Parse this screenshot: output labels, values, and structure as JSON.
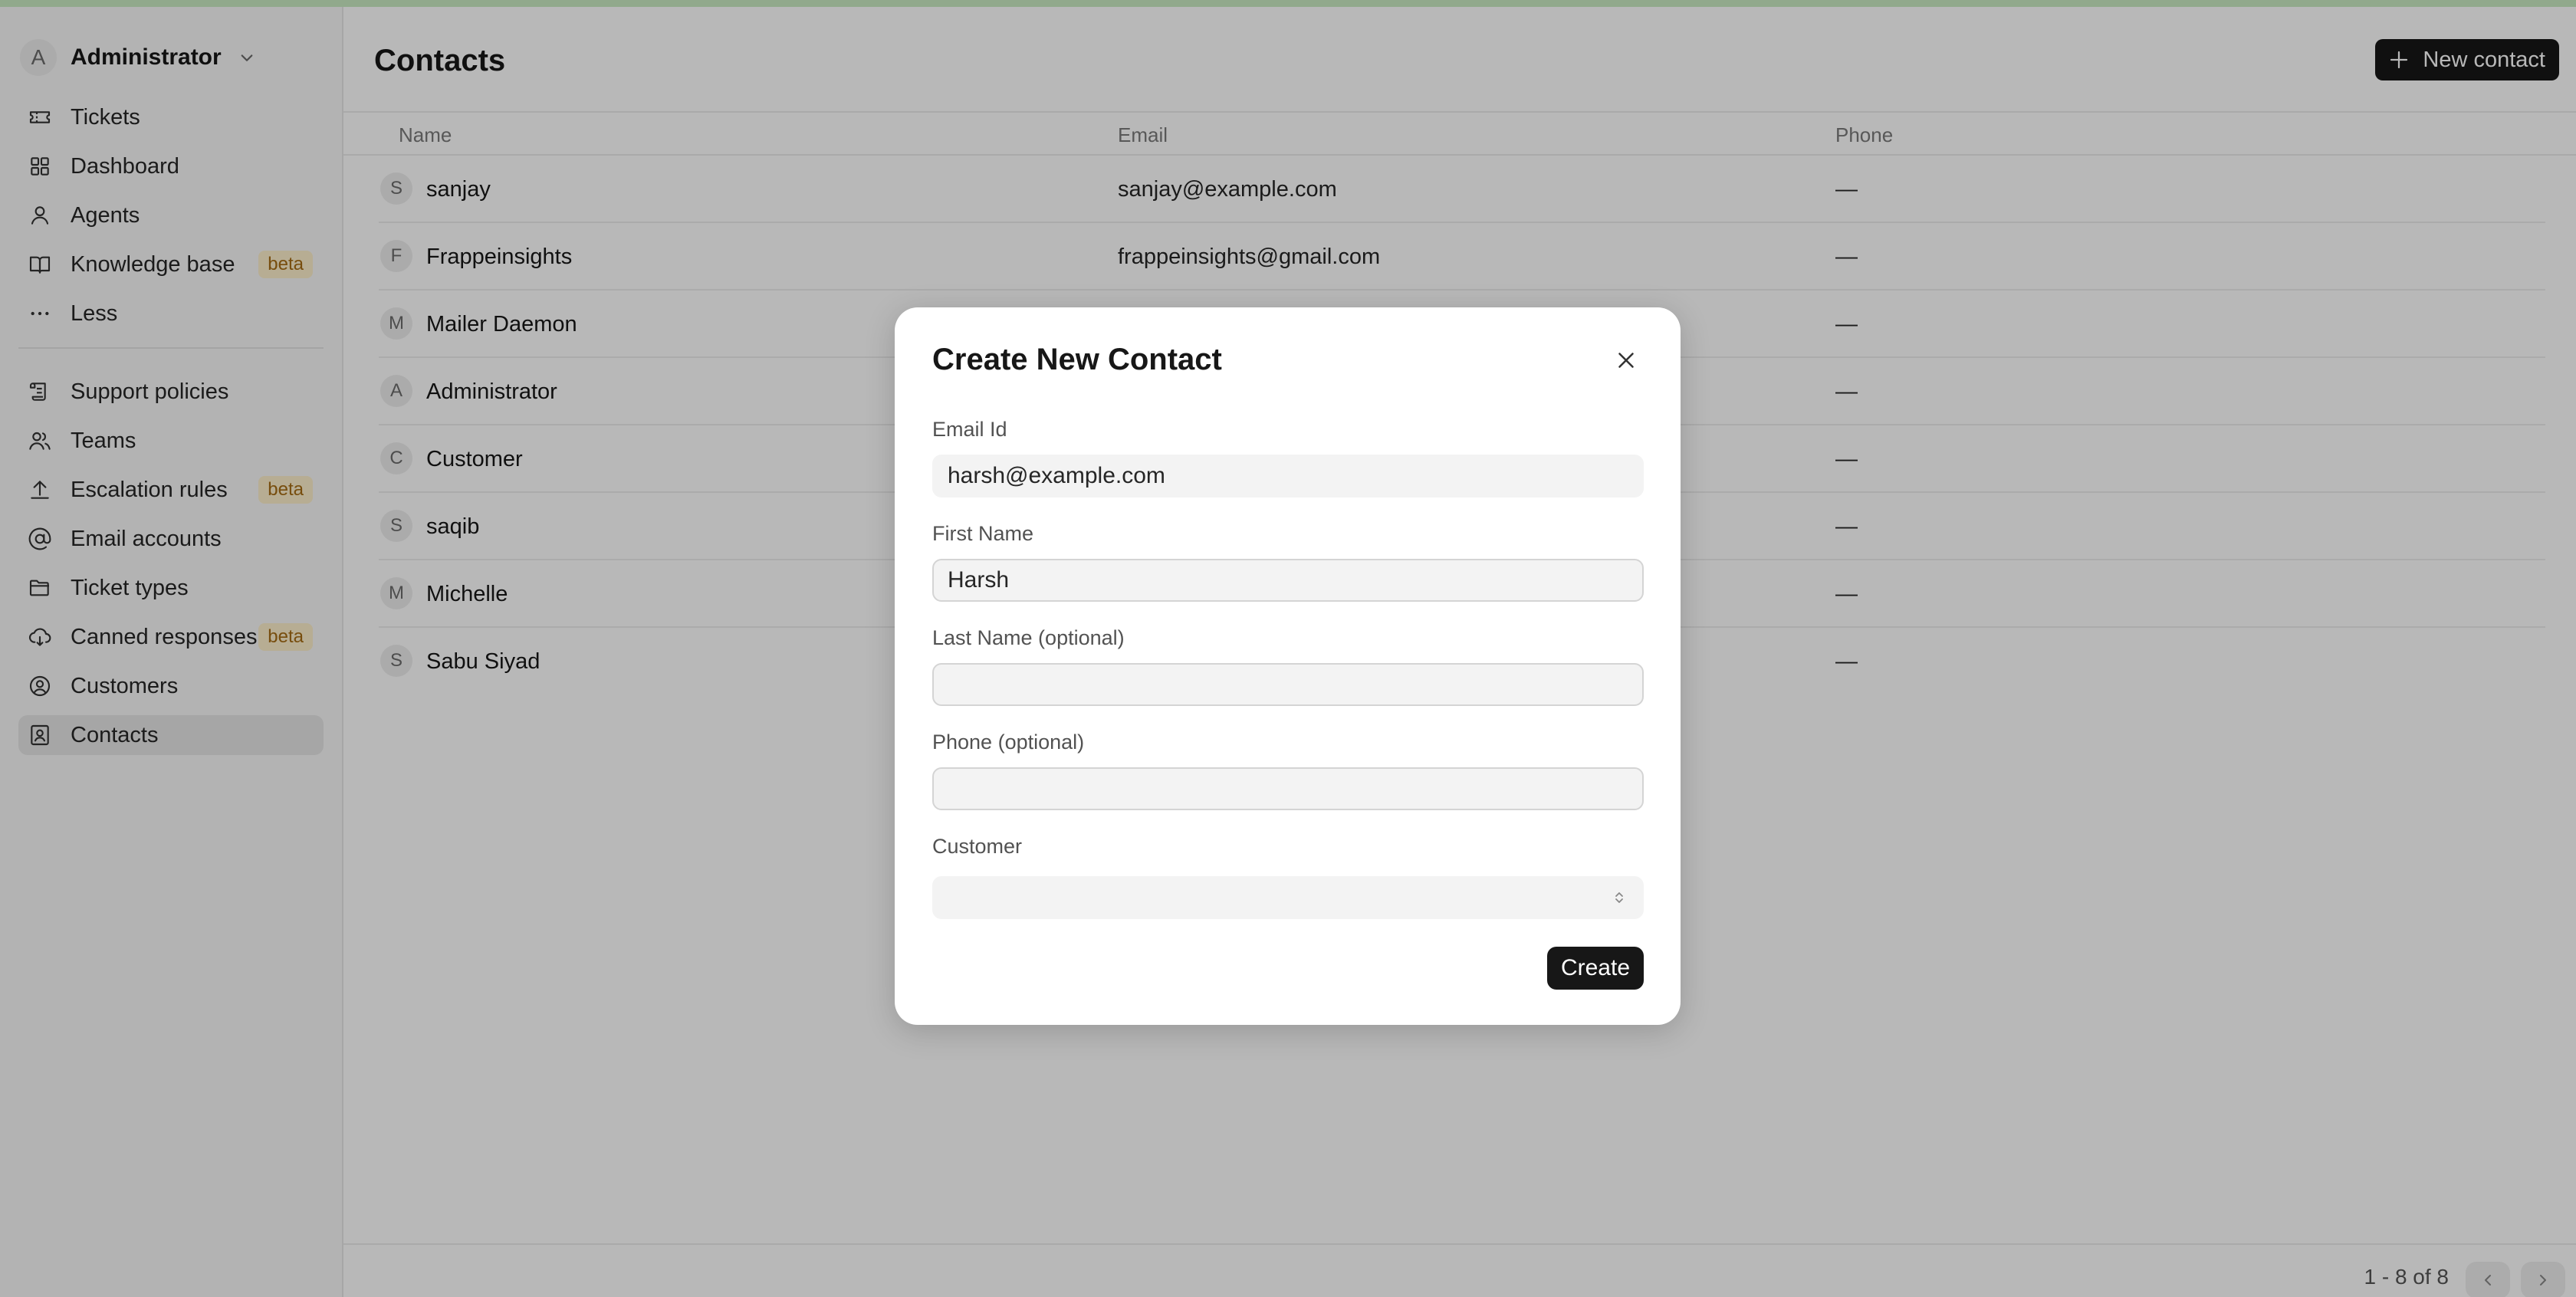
{
  "account": {
    "initial": "A",
    "name": "Administrator"
  },
  "sidebar": {
    "items": [
      {
        "label": "Tickets",
        "icon": "ticket-icon"
      },
      {
        "label": "Dashboard",
        "icon": "dashboard-icon"
      },
      {
        "label": "Agents",
        "icon": "user-icon"
      },
      {
        "label": "Knowledge base",
        "icon": "book-icon",
        "badge": "beta"
      },
      {
        "label": "Less",
        "icon": "more-horizontal-icon"
      }
    ],
    "items2": [
      {
        "label": "Support policies",
        "icon": "scroll-icon"
      },
      {
        "label": "Teams",
        "icon": "users-icon"
      },
      {
        "label": "Escalation rules",
        "icon": "upload-icon",
        "badge": "beta"
      },
      {
        "label": "Email accounts",
        "icon": "at-sign-icon"
      },
      {
        "label": "Ticket types",
        "icon": "folder-icon"
      },
      {
        "label": "Canned responses",
        "icon": "cloud-icon",
        "badge": "beta"
      },
      {
        "label": "Customers",
        "icon": "user-circle-icon"
      },
      {
        "label": "Contacts",
        "icon": "contact-icon"
      }
    ]
  },
  "page": {
    "title": "Contacts",
    "new_button": "New contact"
  },
  "table": {
    "headers": {
      "name": "Name",
      "email": "Email",
      "phone": "Phone"
    },
    "rows": [
      {
        "initial": "S",
        "name": "sanjay",
        "email": "sanjay@example.com",
        "phone": "—"
      },
      {
        "initial": "F",
        "name": "Frappeinsights",
        "email": "frappeinsights@gmail.com",
        "phone": "—"
      },
      {
        "initial": "M",
        "name": "Mailer Daemon",
        "email": "",
        "phone": "—"
      },
      {
        "initial": "A",
        "name": "Administrator",
        "email": "",
        "phone": "—"
      },
      {
        "initial": "C",
        "name": "Customer",
        "email": "",
        "phone": "—"
      },
      {
        "initial": "S",
        "name": "saqib",
        "email": "",
        "phone": "—"
      },
      {
        "initial": "M",
        "name": "Michelle",
        "email": "",
        "phone": "—"
      },
      {
        "initial": "S",
        "name": "Sabu Siyad",
        "email": "",
        "phone": "—"
      }
    ]
  },
  "pagination": {
    "label": "1 - 8 of 8"
  },
  "modal": {
    "title": "Create New Contact",
    "email_label": "Email Id",
    "email_value": "harsh@example.com",
    "first_name_label": "First Name",
    "first_name_value": "Harsh",
    "last_name_label": "Last Name (optional)",
    "last_name_value": "",
    "phone_label": "Phone (optional)",
    "phone_value": "",
    "customer_label": "Customer",
    "customer_value": "",
    "create_button": "Create"
  }
}
